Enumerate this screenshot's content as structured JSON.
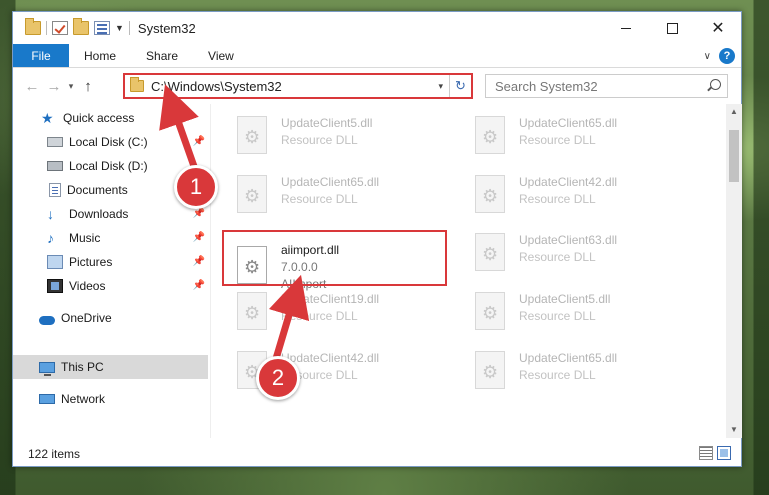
{
  "window": {
    "title": "System32",
    "controls": {
      "minimize": "—",
      "maximize": "□",
      "close": "✕"
    }
  },
  "ribbon": {
    "tabs": [
      {
        "label": "File"
      },
      {
        "label": "Home"
      },
      {
        "label": "Share"
      },
      {
        "label": "View"
      }
    ],
    "help": "?"
  },
  "navigation": {
    "back": "←",
    "forward": "→",
    "recent": "▾",
    "up": "↑",
    "address": "C:\\Windows\\System32",
    "address_dropdown": "▾",
    "refresh": "↻",
    "search_placeholder": "Search System32"
  },
  "sidebar": {
    "items": [
      {
        "label": "Quick access",
        "icon": "star-icon"
      },
      {
        "label": "Local Disk (C:)",
        "icon": "disk-icon"
      },
      {
        "label": "Local Disk (D:)",
        "icon": "disk-icon"
      },
      {
        "label": "Documents",
        "icon": "documents-icon"
      },
      {
        "label": "Downloads",
        "icon": "download-arrow-icon"
      },
      {
        "label": "Music",
        "icon": "music-note-icon"
      },
      {
        "label": "Pictures",
        "icon": "pictures-icon"
      },
      {
        "label": "Videos",
        "icon": "video-icon"
      },
      {
        "label": "OneDrive",
        "icon": "cloud-icon"
      },
      {
        "label": "This PC",
        "icon": "computer-icon"
      },
      {
        "label": "Network",
        "icon": "network-icon"
      }
    ]
  },
  "files": [
    {
      "name": "UpdateClient5.dll",
      "desc": "Resource DLL"
    },
    {
      "name": "UpdateClient65.dll",
      "desc": "Resource DLL"
    },
    {
      "name": "UpdateClient65.dll",
      "desc": "Resource DLL"
    },
    {
      "name": "UpdateClient42.dll",
      "desc": "Resource DLL"
    },
    {
      "name": "aiimport.dll",
      "version": "7.0.0.0",
      "desc": "AIImport"
    },
    {
      "name": "UpdateClient63.dll",
      "desc": "Resource DLL"
    },
    {
      "name": "UpdateClient19.dll",
      "desc": "Resource DLL"
    },
    {
      "name": "UpdateClient5.dll",
      "desc": "Resource DLL"
    },
    {
      "name": "UpdateClient42.dll",
      "desc": "Resource DLL"
    },
    {
      "name": "UpdateClient65.dll",
      "desc": "Resource DLL"
    }
  ],
  "status": {
    "item_count": "122 items"
  },
  "annotations": {
    "step1": "1",
    "step2": "2"
  },
  "colors": {
    "accent": "#1979ca",
    "highlight": "#d9383a"
  }
}
